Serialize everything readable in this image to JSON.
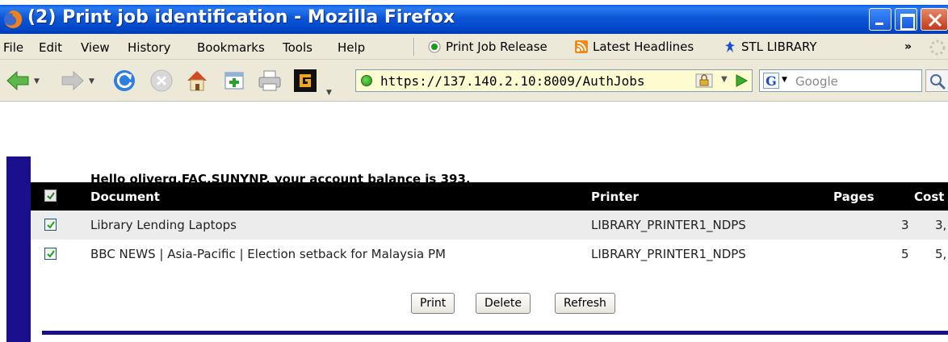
{
  "window": {
    "title": "(2) Print job identification - Mozilla Firefox"
  },
  "menu": {
    "items": [
      "File",
      "Edit",
      "View",
      "History",
      "Bookmarks",
      "Tools",
      "Help"
    ]
  },
  "bookmarks": {
    "items": [
      {
        "label": "Print Job Release",
        "icon": "green-dot-icon"
      },
      {
        "label": "Latest Headlines",
        "icon": "rss-feed-icon"
      },
      {
        "label": "STL LIBRARY",
        "icon": "bookmark-figure-icon"
      }
    ],
    "overflow": "»"
  },
  "navigation": {
    "url": "https://137.140.2.10:8009/AuthJobs",
    "search_placeholder": "Google"
  },
  "page": {
    "greeting": "Hello oliverg.FAC.SUNYNP, your account balance is 393.",
    "table": {
      "headers": {
        "document": "Document",
        "printer": "Printer",
        "pages": "Pages",
        "cost": "Cost"
      },
      "rows": [
        {
          "document": "Library Lending Laptops",
          "printer": "LIBRARY_PRINTER1_NDPS",
          "pages": "3",
          "cost": "3,",
          "checked": true
        },
        {
          "document": "BBC NEWS | Asia-Pacific | Election setback for Malaysia PM",
          "printer": "LIBRARY_PRINTER1_NDPS",
          "pages": "5",
          "cost": "5,",
          "checked": true
        }
      ]
    },
    "buttons": {
      "print": "Print",
      "delete": "Delete",
      "refresh": "Refresh"
    }
  },
  "colors": {
    "titlebar": "#0047c8",
    "table_header": "#000000",
    "accent_navy": "#1a0f8c",
    "url_background": "#fffbd0"
  }
}
